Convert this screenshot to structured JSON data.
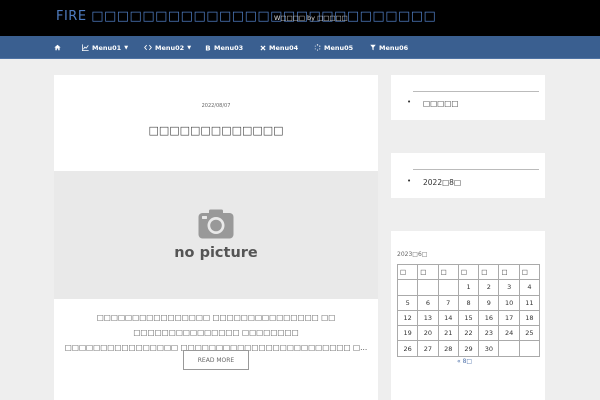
{
  "header": {
    "site_title": "FIRE □□□□□□□□□□□□□□□□□□□□□□□□□□□",
    "site_subtitle": "W□□□□ by □□□□□"
  },
  "nav": {
    "items": [
      {
        "icon": "home-icon",
        "label": "",
        "caret": ""
      },
      {
        "icon": "line-chart-icon",
        "label": "Menu01",
        "caret": "▼"
      },
      {
        "icon": "code-icon",
        "label": "Menu02",
        "caret": "▼"
      },
      {
        "icon": "bitcoin-icon",
        "label": "Menu03",
        "caret": ""
      },
      {
        "icon": "close-icon",
        "label": "Menu04",
        "caret": ""
      },
      {
        "icon": "spinner-icon",
        "label": "Menu05",
        "caret": ""
      },
      {
        "icon": "filter-icon",
        "label": "Menu06",
        "caret": ""
      }
    ]
  },
  "article": {
    "date": "2022/08/07",
    "title": "□□□□□□□□□□□□□",
    "thumbnail_label": "no picture",
    "excerpt_line1": "□□□□□□□□□□□□□□□□ □□□□□□□□□□□□□□□ □□ □□□□□□□□□□□□□□□ □□□□□□□□",
    "excerpt_line2": "□□□□□□□□□□□□□□□□ □□□□□□□□□□□□□□□□□□□□□□□□ □...",
    "read_more": "READ MORE"
  },
  "sidebar": {
    "categories": [
      "□□□□□"
    ],
    "archives": [
      "2022□8□"
    ],
    "calendar": {
      "caption": "2023□6□",
      "headers": [
        "□",
        "□",
        "□",
        "□",
        "□",
        "□",
        "□"
      ],
      "rows": [
        [
          "",
          "",
          "",
          "1",
          "2",
          "3",
          "4"
        ],
        [
          "5",
          "6",
          "7",
          "8",
          "9",
          "10",
          "11"
        ],
        [
          "12",
          "13",
          "14",
          "15",
          "16",
          "17",
          "18"
        ],
        [
          "19",
          "20",
          "21",
          "22",
          "23",
          "24",
          "25"
        ],
        [
          "26",
          "27",
          "28",
          "29",
          "30",
          "",
          ""
        ]
      ],
      "prev_link": "« 8□"
    }
  },
  "colors": {
    "topbar": "#000000",
    "navbar": "#3a5f90",
    "site_title": "#4f7cc0",
    "link": "#4a6ea8"
  }
}
